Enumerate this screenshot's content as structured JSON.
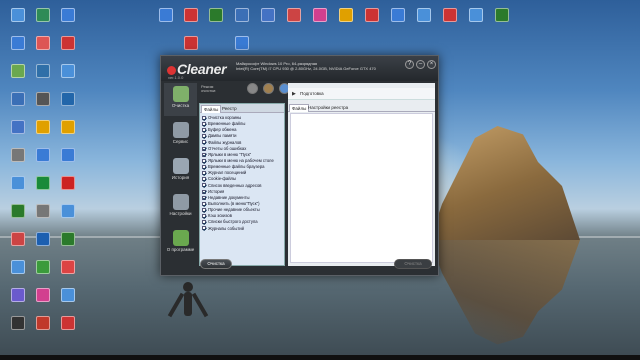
{
  "desktop": {
    "icons": [
      {
        "label": "",
        "color": "#4a90d9"
      },
      {
        "label": "",
        "color": "#3a7bd5"
      },
      {
        "label": "",
        "color": "#6aa84f"
      },
      {
        "label": "",
        "color": "#3b6fb6"
      },
      {
        "label": "",
        "color": "#4472c4"
      },
      {
        "label": "",
        "color": "#777777"
      },
      {
        "label": "",
        "color": "#4a90d9"
      },
      {
        "label": "",
        "color": "#2b7a2b"
      },
      {
        "label": "",
        "color": "#cc4444"
      },
      {
        "label": "",
        "color": "#4a90d9"
      },
      {
        "label": "",
        "color": "#6a5acd"
      },
      {
        "label": "",
        "color": "#333333"
      },
      {
        "label": "",
        "color": "#2e8b57"
      },
      {
        "label": "",
        "color": "#dd5555"
      },
      {
        "label": "",
        "color": "#2f6fa8"
      },
      {
        "label": "",
        "color": "#555555"
      },
      {
        "label": "",
        "color": "#e0a000"
      },
      {
        "label": "",
        "color": "#3a7bd5"
      },
      {
        "label": "",
        "color": "#1a8a3a"
      },
      {
        "label": "",
        "color": "#777777"
      },
      {
        "label": "",
        "color": "#1c5fb0"
      },
      {
        "label": "",
        "color": "#3b9b3b"
      },
      {
        "label": "",
        "color": "#d23f8f"
      },
      {
        "label": "",
        "color": "#c0392b"
      },
      {
        "label": "",
        "color": "#3a7bd5"
      },
      {
        "label": "",
        "color": "#cc3333"
      },
      {
        "label": "",
        "color": "#4a90d9"
      },
      {
        "label": "",
        "color": "#2266aa"
      },
      {
        "label": "",
        "color": "#e0a000"
      },
      {
        "label": "",
        "color": "#3a7bd5"
      },
      {
        "label": "",
        "color": "#cc2222"
      },
      {
        "label": "",
        "color": "#4a90d9"
      },
      {
        "label": "",
        "color": "#2b7a2b"
      },
      {
        "label": "",
        "color": "#dd4444"
      },
      {
        "label": "",
        "color": "#4a90d9"
      },
      {
        "label": "",
        "color": "#c33"
      },
      {
        "label": "",
        "color": "#3a7bd5"
      },
      {
        "label": "",
        "color": "#cc3333"
      },
      {
        "label": "",
        "color": "#2b7a2b"
      },
      {
        "label": "",
        "color": "#3b6fb6"
      },
      {
        "label": "",
        "color": "#4472c4"
      },
      {
        "label": "",
        "color": "#cc4444"
      },
      {
        "label": "",
        "color": "#d23f8f"
      },
      {
        "label": "",
        "color": "#e0a000"
      },
      {
        "label": "",
        "color": "#cc3333"
      },
      {
        "label": "",
        "color": "#3a7bd5"
      },
      {
        "label": "",
        "color": "#4a90d9"
      },
      {
        "label": "",
        "color": "#cc3333"
      },
      {
        "label": "",
        "color": "#4a90d9"
      },
      {
        "label": "",
        "color": "#2b7a2b"
      },
      {
        "label": "",
        "color": "#cc3333"
      },
      {
        "label": "",
        "color": "#3a7bd5"
      }
    ]
  },
  "app": {
    "logo": "Cleaner",
    "version": "ver.1.0.0",
    "sysinfo_line1": "Майкрософт Windows 10 Pro, 64-разрядная",
    "sysinfo_line2": "Intel(R) Core(TM) i7 CPU 930 @ 2.80GHz, 24.0GB, NVIDIA GeForce GTX 470",
    "win_buttons": {
      "help": "?",
      "minimize": "–",
      "close": "×"
    },
    "mode_label_line1": "Режим",
    "mode_label_line2": "очистки:",
    "mode_icons": [
      "#888888",
      "#a08050",
      "#5a8fd0",
      "#6aa84f",
      "#7a7a7a"
    ],
    "sidebar": [
      {
        "label": "Очистка",
        "icon": "broom-icon",
        "color": "#7fb06a"
      },
      {
        "label": "Сервис",
        "icon": "wrench-icon",
        "color": "#8f9aa5"
      },
      {
        "label": "История",
        "icon": "clock-icon",
        "color": "#9aa6b2"
      },
      {
        "label": "Настройки",
        "icon": "gear-icon",
        "color": "#8f9aa5"
      },
      {
        "label": "О программе",
        "icon": "info-icon",
        "color": "#6aa84f"
      }
    ],
    "left_tabs": [
      "Файлы",
      "Реестр"
    ],
    "checklist": [
      "Очистка корзины",
      "Временные файлы",
      "Буфер обмена",
      "Дампы памяти",
      "Файлы журналов",
      "Отчеты об ошибках",
      "Ярлыки в меню \"Пуск\"",
      "Ярлыки в меню на рабочем столе",
      "Временные файлы браузера",
      "Журнал посещений",
      "Cookie-файлы",
      "Список введенных адресов",
      "История",
      "Недавние документы",
      "Выполнить (в меню\"Пуск\")",
      "Прочие недавние объекты",
      "Кэш эскизов",
      "Списки быстрого доступа",
      "Журналы событий"
    ],
    "analysis_label": "Подготовка",
    "right_tabs": [
      "Файлы",
      "Настройки реестра"
    ],
    "analyze_button": "Очистка",
    "clean_button": "Очистка"
  }
}
